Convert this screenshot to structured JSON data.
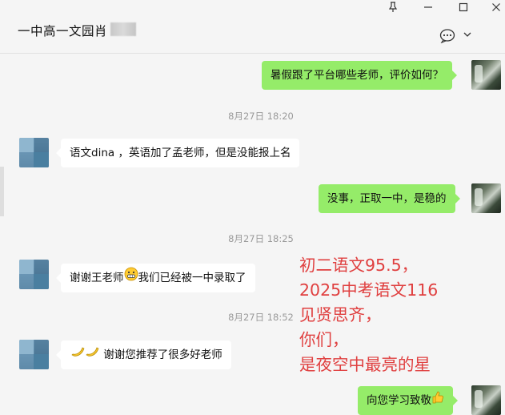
{
  "window": {
    "title": "一中高一文园肖",
    "pin_icon": "pin-icon",
    "minimize_icon": "minimize-icon",
    "maximize_icon": "maximize-icon",
    "close_icon": "close-icon"
  },
  "toolbar": {
    "more_icon": "chat-bubble-more-icon",
    "dropdown_icon": "chevron-down-icon"
  },
  "messages": [
    {
      "side": "right",
      "text": "暑假跟了平台哪些老师，评价如何？"
    },
    {
      "timestamp": "8月27日 18:20"
    },
    {
      "side": "left",
      "text": "语文dina ，英语加了孟老师，但是没能报上名"
    },
    {
      "side": "right",
      "text": "没事，正取一中，是稳的"
    },
    {
      "timestamp": "8月27日 18:25"
    },
    {
      "side": "left",
      "text_before": "谢谢王老师",
      "emoji": "grin-emoji",
      "text_after": "我们已经被一中录取了"
    },
    {
      "timestamp": "8月27日 18:52"
    },
    {
      "side": "left",
      "emoji": "banana-emoji",
      "text": "谢谢您推荐了很多好老师"
    },
    {
      "side": "right",
      "text": "向您学习致敬",
      "emoji": "thumbs-up-emoji"
    }
  ],
  "overlay_lines": [
    "初二语文95.5，",
    "2025中考语文116",
    "见贤思齐，",
    "你们，",
    "是夜空中最亮的星"
  ],
  "colors": {
    "outgoing_bubble": "#95ec69",
    "incoming_bubble": "#ffffff",
    "overlay_text": "#e04040",
    "timestamp_text": "#9a9a9a"
  }
}
